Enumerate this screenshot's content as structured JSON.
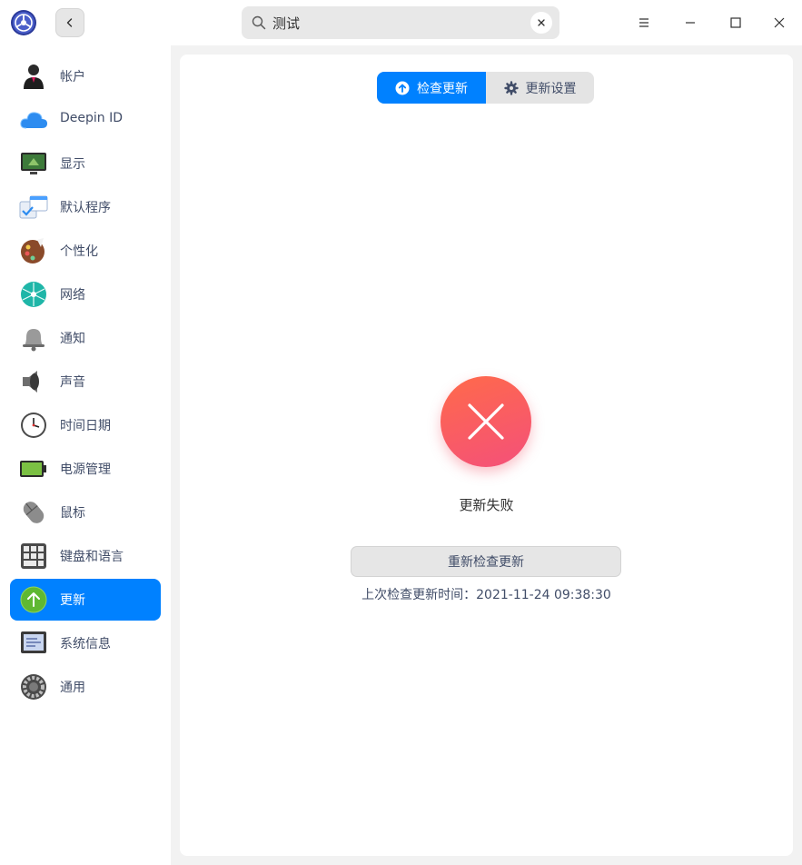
{
  "titlebar": {
    "search": {
      "value": "测试"
    }
  },
  "sidebar": {
    "items": [
      {
        "label": "帐户",
        "icon": "account-icon"
      },
      {
        "label": "Deepin ID",
        "icon": "cloud-icon"
      },
      {
        "label": "显示",
        "icon": "display-icon"
      },
      {
        "label": "默认程序",
        "icon": "default-apps-icon"
      },
      {
        "label": "个性化",
        "icon": "palette-icon"
      },
      {
        "label": "网络",
        "icon": "network-icon"
      },
      {
        "label": "通知",
        "icon": "bell-icon"
      },
      {
        "label": "声音",
        "icon": "speaker-icon"
      },
      {
        "label": "时间日期",
        "icon": "clock-icon"
      },
      {
        "label": "电源管理",
        "icon": "battery-icon"
      },
      {
        "label": "鼠标",
        "icon": "mouse-icon"
      },
      {
        "label": "键盘和语言",
        "icon": "keyboard-icon"
      },
      {
        "label": "更新",
        "icon": "update-icon",
        "active": true
      },
      {
        "label": "系统信息",
        "icon": "system-info-icon"
      },
      {
        "label": "通用",
        "icon": "general-gear-icon"
      }
    ]
  },
  "main": {
    "tabs": [
      {
        "label": "检查更新",
        "icon": "arrow-up-circle-icon",
        "selected": true
      },
      {
        "label": "更新设置",
        "icon": "gear-icon",
        "selected": false
      }
    ],
    "status": "更新失败",
    "retry_label": "重新检查更新",
    "last_check_label": "上次检查更新时间：",
    "last_check_time": "2021-11-24 09:38:30"
  },
  "colors": {
    "accent": "#0081ff",
    "error_gradient_start": "#ff6a4a",
    "error_gradient_end": "#f4507a",
    "text": "#414d68"
  }
}
